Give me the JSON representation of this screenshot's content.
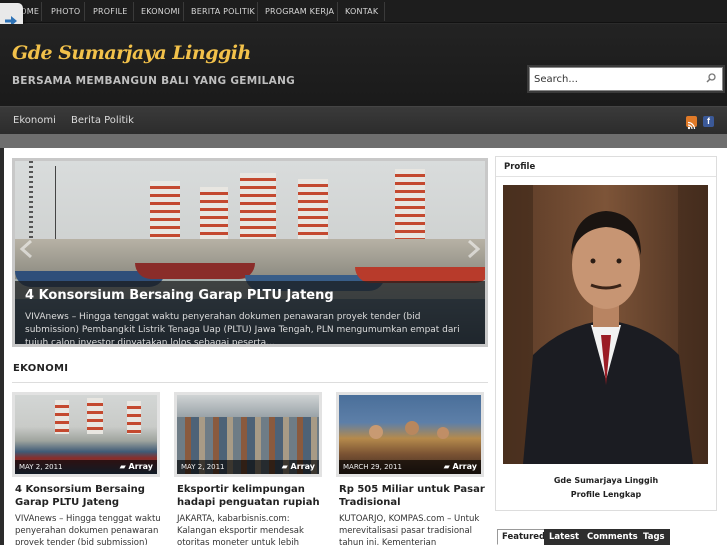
{
  "topnav": {
    "items": [
      {
        "label": "HOME"
      },
      {
        "label": "PHOTO"
      },
      {
        "label": "PROFILE"
      },
      {
        "label": "EKONOMI"
      },
      {
        "label": "BERITA POLITIK"
      },
      {
        "label": "PROGRAM KERJA"
      },
      {
        "label": "KONTAK"
      }
    ]
  },
  "header": {
    "title": "Gde Sumarjaya Linggih",
    "tagline": "BERSAMA MEMBANGUN BALI YANG GEMILANG",
    "search_placeholder": "Search..."
  },
  "category_nav": {
    "items": [
      {
        "label": "Ekonomi"
      },
      {
        "label": "Berita Politik"
      }
    ],
    "icons": [
      "rss-icon",
      "facebook-icon"
    ],
    "facebook_glyph": "f"
  },
  "slider": {
    "title": "4 Konsorsium Bersaing Garap PLTU Jateng",
    "excerpt": "VIVAnews – Hingga tenggat waktu penyerahan dokumen penawaran proyek tender (bid submission) Pembangkit Listrik Tenaga Uap (PLTU) Jawa Tengah, PLN mengumumkan empat dari tujuh calon investor dinyatakan lolos sebagai peserta..."
  },
  "ekonomi": {
    "heading": "EKONOMI",
    "posts": [
      {
        "date": "MAY 2, 2011",
        "tag": "Array",
        "title": "4 Konsorsium Bersaing Garap PLTU Jateng",
        "excerpt": "VIVAnews – Hingga tenggat waktu penyerahan dokumen penawaran proyek tender (bid submission)"
      },
      {
        "date": "MAY 2, 2011",
        "tag": "Array",
        "title": "Eksportir kelimpungan hadapi penguatan rupiah",
        "excerpt": "JAKARTA, kabarbisnis.com: Kalangan eksportir mendesak otoritas moneter untuk lebih"
      },
      {
        "date": "MARCH 29, 2011",
        "tag": "Array",
        "title": "Rp 505 Miliar untuk Pasar Tradisional",
        "excerpt": "KUTOARJO, KOMPAS.com – Untuk merevitalisasi pasar tradisional tahun ini, Kementerian Perdagangan"
      }
    ]
  },
  "sidebar": {
    "profile": {
      "heading": "Profile",
      "name": "Gde Sumarjaya Linggih",
      "link": "Profile Lengkap"
    },
    "tabs": [
      {
        "label": "Featured",
        "active": true
      },
      {
        "label": "Latest",
        "active": false
      },
      {
        "label": "Comments",
        "active": false
      },
      {
        "label": "Tags",
        "active": false
      }
    ]
  },
  "colors": {
    "title_accent": "#f2c14a",
    "background": "#2b2b2b",
    "rss": "#e07a28",
    "facebook": "#3b5998"
  }
}
